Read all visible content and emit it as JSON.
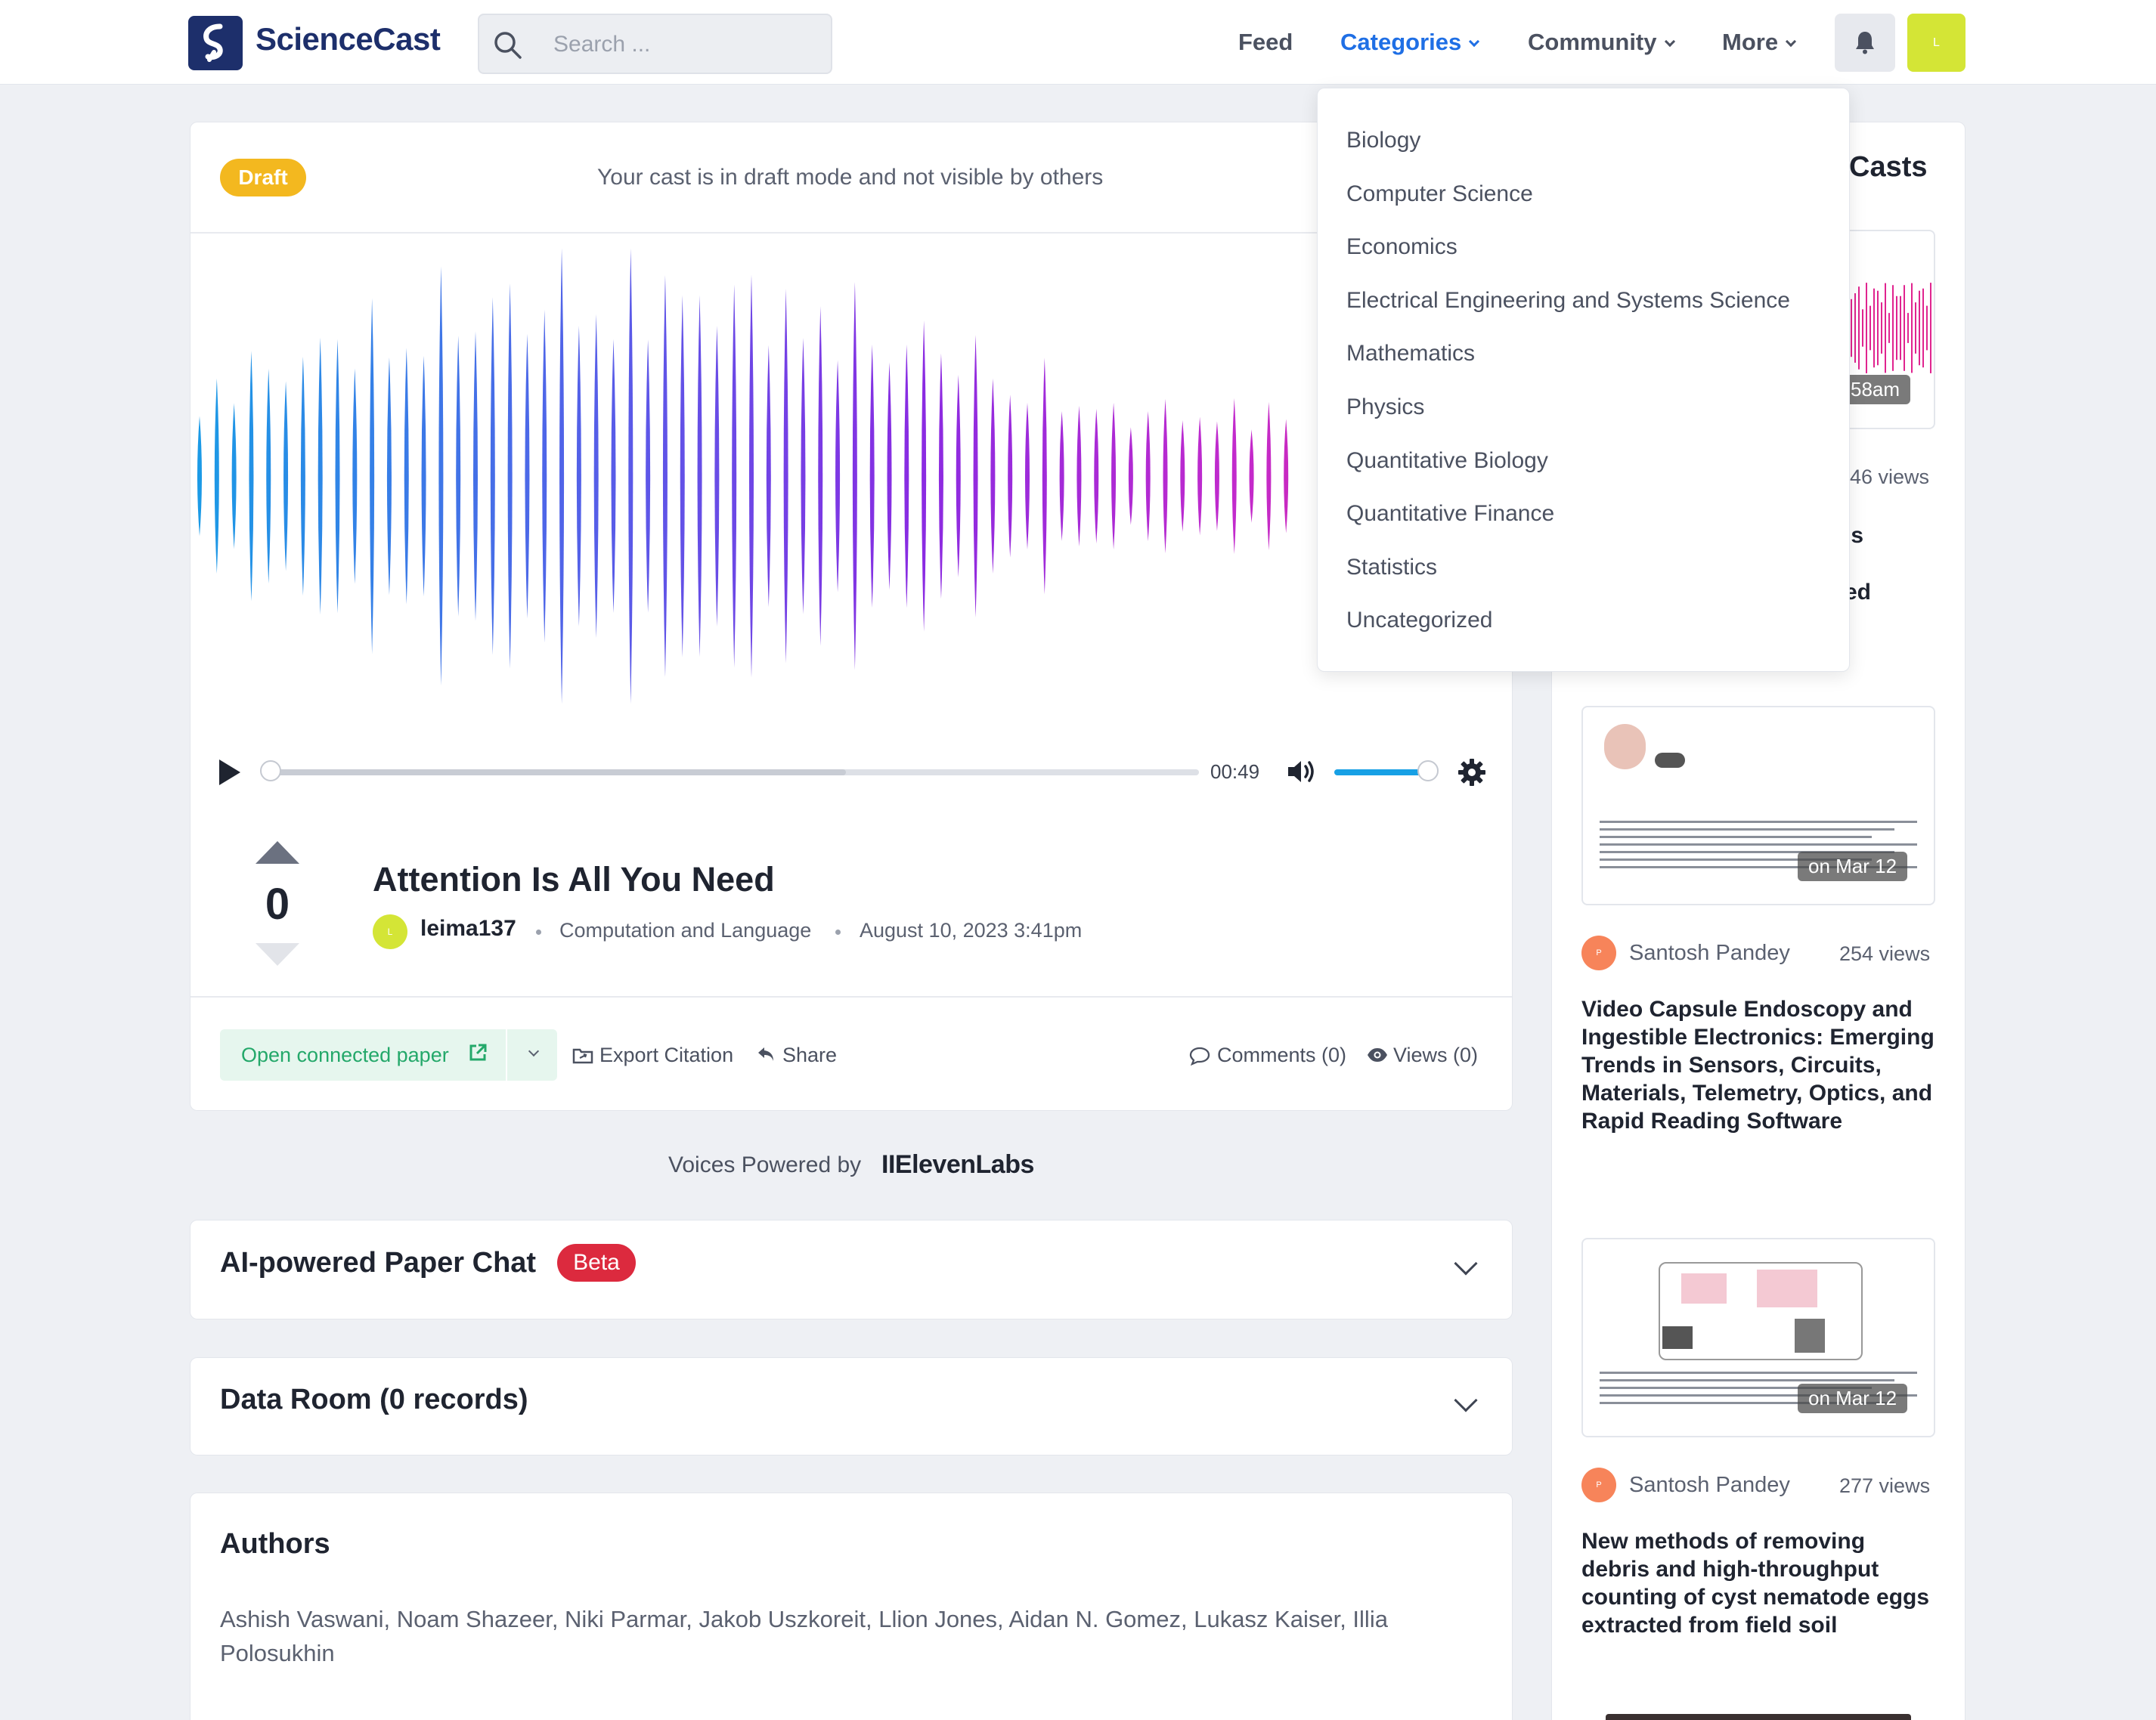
{
  "brand": {
    "name": "ScienceCast"
  },
  "search": {
    "placeholder": "Search ..."
  },
  "nav": {
    "feed": "Feed",
    "categories": "Categories",
    "community": "Community",
    "more": "More"
  },
  "user": {
    "avatar_initial": "L"
  },
  "categories_menu": [
    "Biology",
    "Computer Science",
    "Economics",
    "Electrical Engineering and Systems Science",
    "Mathematics",
    "Physics",
    "Quantitative Biology",
    "Quantitative Finance",
    "Statistics",
    "Uncategorized"
  ],
  "draft": {
    "badge": "Draft",
    "message": "Your cast is in draft mode and not visible by others"
  },
  "player": {
    "time": "00:49",
    "progress": 0.0,
    "buffered": 0.62,
    "volume": 1.0
  },
  "cast": {
    "votes": "0",
    "title": "Attention Is All You Need",
    "author_initial": "L",
    "author": "leima137",
    "category": "Computation and Language",
    "date": "August 10, 2023 3:41pm"
  },
  "actions": {
    "open_paper": "Open connected paper",
    "export_citation": "Export Citation",
    "share": "Share",
    "comments": "Comments (0)",
    "views": "Views (0)"
  },
  "powered": {
    "label": "Voices Powered by",
    "brand": "IIElevenLabs"
  },
  "panels": {
    "paper_chat": "AI-powered Paper Chat",
    "beta": "Beta",
    "data_room": "Data Room (0 records)",
    "authors_title": "Authors",
    "authors": "Ashish Vaswani, Noam Shazeer, Niki Parmar, Jakob Uszkoreit, Llion Jones, Aidan N. Gomez, Lukasz Kaiser, Illia Polosukhin"
  },
  "sidebar": {
    "title_fragment": "Casts",
    "first": {
      "date_fragment": "58am",
      "views": "46 views",
      "title_fragment_1": "ıs",
      "title_fragment_2": "ed"
    },
    "items": [
      {
        "date": "on Mar 12",
        "author_initial": "P",
        "author": "Santosh Pandey",
        "views": "254 views",
        "title": "Video Capsule Endoscopy and Ingestible Electronics: Emerging Trends in Sensors, Circuits, Materials, Telemetry, Optics, and Rapid Reading Software"
      },
      {
        "date": "on Mar 12",
        "author_initial": "P",
        "author": "Santosh Pandey",
        "views": "277 views",
        "title": "New methods of removing debris and high-throughput counting of cyst nematode eggs extracted from field soil"
      }
    ]
  },
  "colors": {
    "brand": "#1d2f6b",
    "accent": "#1f6fe5",
    "draft": "#f3b81f",
    "beta": "#dc2a3e",
    "success": "#24a86a",
    "wave_start": "#1a9be6",
    "wave_mid": "#8a2be2",
    "wave_end": "#e0248f"
  }
}
